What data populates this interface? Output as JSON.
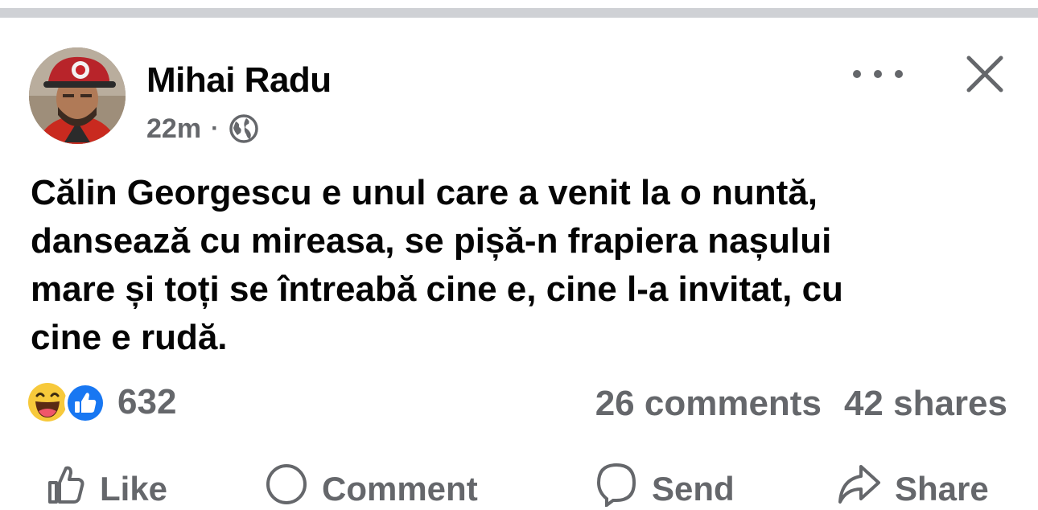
{
  "post": {
    "author": "Mihai Radu",
    "time": "22m",
    "separator": "·",
    "audience_icon": "globe-icon",
    "text_lines": [
      "Călin Georgescu e unul care a venit la o nuntă,",
      "dansează cu mireasa, se pișă-n frapiera nașului",
      "mare și toți se întreabă cine e, cine l-a invitat, cu",
      "cine e rudă."
    ],
    "reactions": {
      "icons": [
        "haha-reaction-icon",
        "like-reaction-icon"
      ],
      "count": "632"
    },
    "comments": "26 comments",
    "shares": "42 shares",
    "actions": {
      "like": "Like",
      "comment": "Comment",
      "send": "Send",
      "share": "Share"
    }
  },
  "colors": {
    "text_primary": "#050505",
    "text_secondary": "#65676b",
    "like_blue": "#1877f2",
    "haha_yellow": "#f7c93b",
    "divider": "#cfd1d5"
  }
}
